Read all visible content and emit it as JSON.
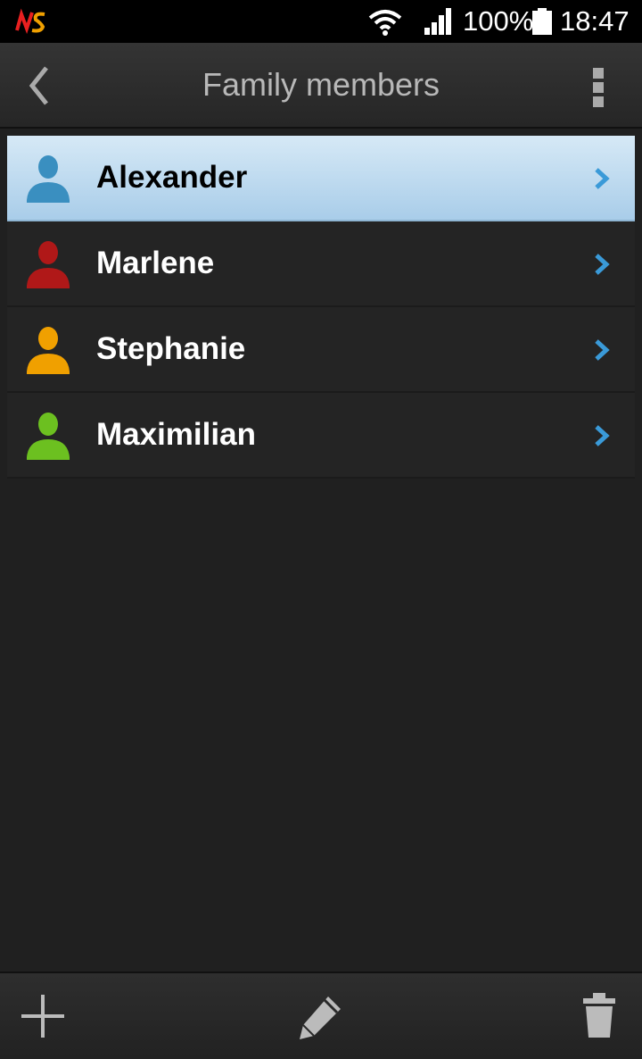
{
  "status_bar": {
    "battery_percent": "100%",
    "time": "18:47",
    "icons": [
      "app-logo-icon",
      "wifi-icon",
      "signal-icon",
      "battery-icon"
    ]
  },
  "action_bar": {
    "title": "Family members",
    "icons": [
      "back-arrow-icon",
      "overflow-menu-icon"
    ]
  },
  "members": [
    {
      "name": "Alexander",
      "color": "#3a8fc0",
      "selected": true
    },
    {
      "name": "Marlene",
      "color": "#b01818",
      "selected": false
    },
    {
      "name": "Stephanie",
      "color": "#f0a000",
      "selected": false
    },
    {
      "name": "Maximilian",
      "color": "#6cc020",
      "selected": false
    }
  ],
  "toolbar": {
    "icons": [
      "add-icon",
      "edit-pencil-icon",
      "delete-trash-icon"
    ]
  },
  "colors": {
    "background": "#202020",
    "selection": "#b8d8ee",
    "chevron": "#3a9ad8"
  }
}
